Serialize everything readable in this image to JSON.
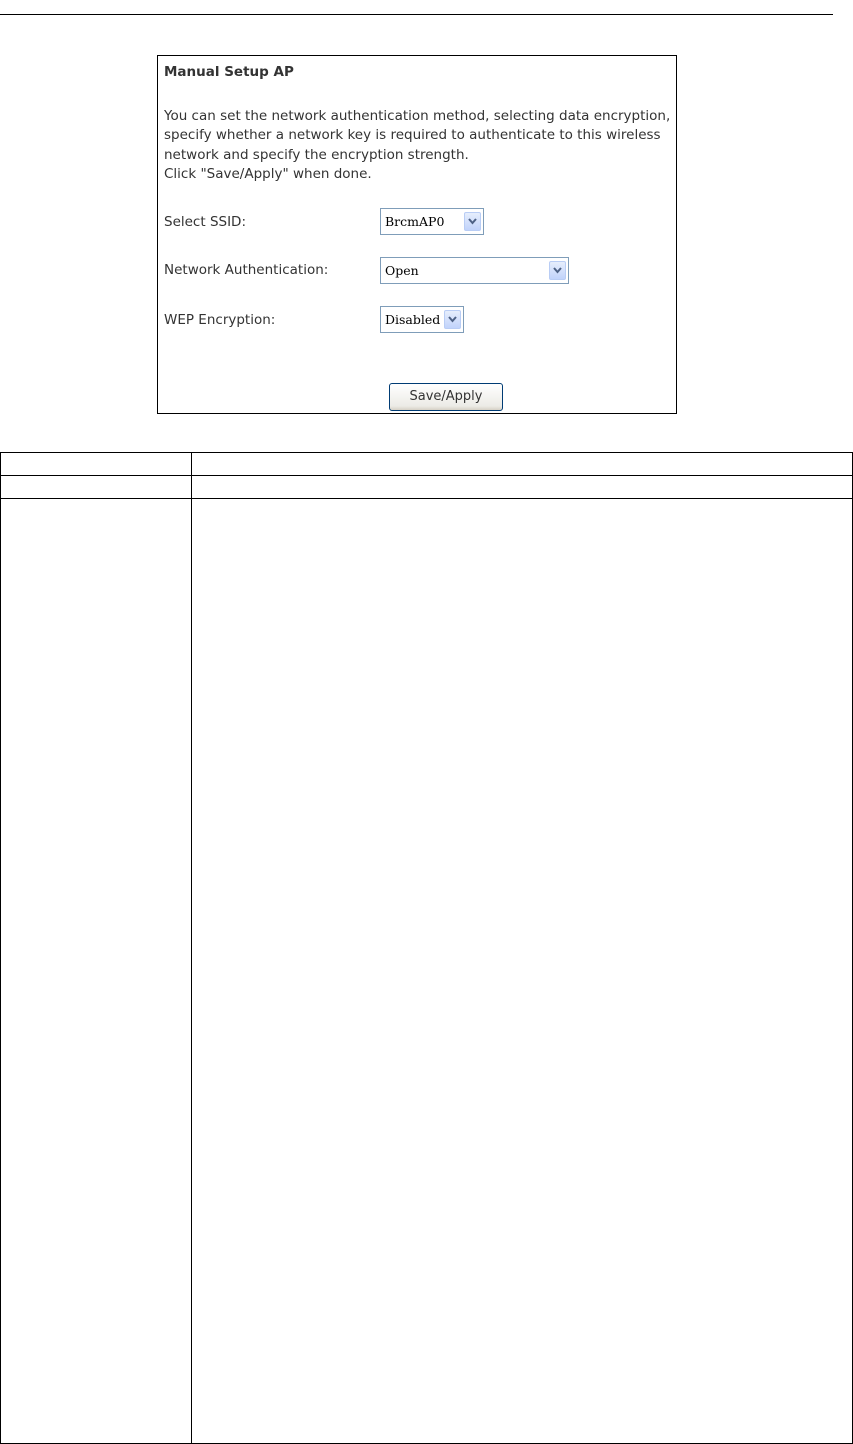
{
  "panel": {
    "title": "Manual Setup AP",
    "description_lines": [
      "You can set the network authentication method, selecting data encryption,",
      "specify whether a network key is required to authenticate to this wireless",
      "network and specify the encryption strength.",
      "Click \"Save/Apply\" when done."
    ],
    "fields": {
      "ssid": {
        "label": "Select SSID:",
        "value": "BrcmAP0"
      },
      "auth": {
        "label": "Network Authentication:",
        "value": "Open"
      },
      "wep": {
        "label": "WEP Encryption:",
        "value": "Disabled"
      }
    },
    "save_label": "Save/Apply"
  },
  "icons": {
    "dropdown": "chevron-down-icon"
  },
  "colors": {
    "text": "#333333",
    "select_border": "#7f9db9",
    "button_border": "#003c74"
  }
}
